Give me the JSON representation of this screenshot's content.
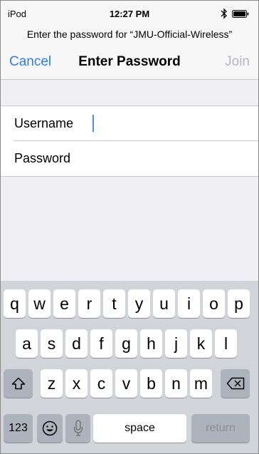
{
  "status_bar": {
    "carrier": "iPod",
    "time": "12:27 PM"
  },
  "prompt": "Enter the password for “JMU-Official-Wireless”",
  "nav": {
    "cancel": "Cancel",
    "title": "Enter Password",
    "join": "Join"
  },
  "form": {
    "username_label": "Username",
    "password_label": "Password",
    "username_value": "",
    "password_value": ""
  },
  "keyboard": {
    "row1": [
      "q",
      "w",
      "e",
      "r",
      "t",
      "y",
      "u",
      "i",
      "o",
      "p"
    ],
    "row2": [
      "a",
      "s",
      "d",
      "f",
      "g",
      "h",
      "j",
      "k",
      "l"
    ],
    "row3": [
      "z",
      "x",
      "c",
      "v",
      "b",
      "n",
      "m"
    ],
    "numbers_key": "123",
    "space_key": "space",
    "return_key": "return"
  },
  "colors": {
    "accent": "#2e7cf6",
    "disabled": "#b7b7bd",
    "keyboard_bg": "#d1d4d9"
  },
  "icons": [
    "bluetooth-icon",
    "battery-icon",
    "shift-icon",
    "backspace-icon",
    "emoji-icon",
    "microphone-icon"
  ]
}
